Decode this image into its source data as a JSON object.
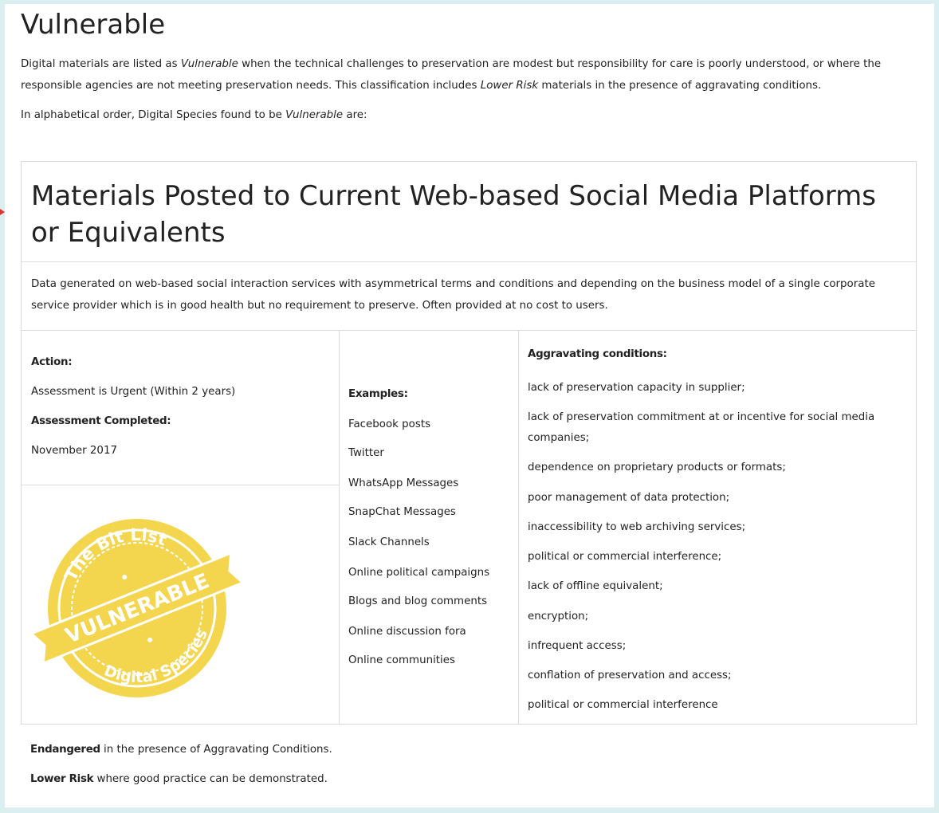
{
  "page": {
    "title": "Vulnerable",
    "intro": {
      "p1_a": "Digital materials are listed as ",
      "p1_em1": "Vulnerable",
      "p1_b": " when the technical challenges to preservation are modest but responsibility for care is poorly understood, or where the responsible agencies are not meeting preservation needs. This classification includes ",
      "p1_em2": "Lower Risk",
      "p1_c": " materials in the presence of aggravating conditions.",
      "p2_a": "In alphabetical order, Digital Species found to be ",
      "p2_em": "Vulnerable",
      "p2_b": " are:"
    }
  },
  "card": {
    "title": "Materials Posted to Current Web-based Social Media Platforms or Equivalents",
    "description": "Data generated on web-based social interaction services with asymmetrical terms and conditions and depending on the business model of a single corporate service provider which is in good health but no requirement to preserve. Often provided at no cost to users.",
    "action_label": "Action:",
    "action_value": "Assessment is Urgent (Within 2 years)",
    "assessment_label": "Assessment Completed:",
    "assessment_value": "November 2017",
    "stamp": {
      "top_text": "The Bit List",
      "band_text": "VULNERABLE",
      "bottom_text": "Digital Species",
      "color": "#f3d64e"
    },
    "examples_label": "Examples:",
    "examples": [
      "Facebook posts",
      "Twitter",
      "WhatsApp Messages",
      "SnapChat Messages",
      "Slack Channels",
      "Online political campaigns",
      "Blogs and blog comments",
      "Online discussion fora",
      "Online communities"
    ],
    "aggravating_label": "Aggravating conditions:",
    "aggravating": [
      "lack of preservation capacity in supplier;",
      "lack of preservation commitment at or incentive for social media companies;",
      "dependence on proprietary products or formats;",
      "poor management of data protection;",
      "inaccessibility to web archiving services;",
      "political or commercial interference;",
      "lack of offline equivalent;",
      "encryption;",
      "infrequent access;",
      "conflation of preservation and access;",
      "political or commercial interference"
    ]
  },
  "footer": {
    "line1_bold": "Endangered",
    "line1_rest": " in the presence of Aggravating Conditions.",
    "line2_bold": "Lower Risk",
    "line2_rest": " where good practice can be demonstrated."
  }
}
